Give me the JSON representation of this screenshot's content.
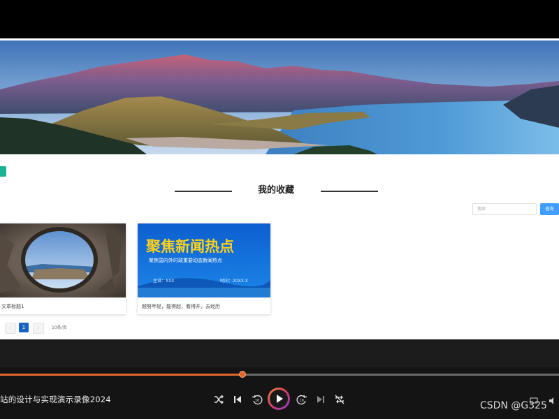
{
  "page": {
    "section_title": "我的收藏",
    "search": {
      "placeholder": "搜索",
      "button_label": "查询"
    },
    "cards": [
      {
        "caption": "文章标题1"
      },
      {
        "caption": "越努年轻，能得起，看得开，去经历",
        "poster_title": "聚焦新闻热点",
        "poster_subtitle": "聚焦国内外时政重要动态新闻热点",
        "poster_left": "主讲：XXX",
        "poster_right": "时间：20XX.X"
      }
    ],
    "pagination": {
      "prev": "‹",
      "current_page": "1",
      "next": "›",
      "page_size": "10条/页"
    }
  },
  "player": {
    "video_title": "站的设计与实现演示录像2024",
    "progress": 0.434,
    "watermark": "CSDN @G325",
    "controls": [
      "shuffle-icon",
      "skip-previous-icon",
      "rewind-10-icon",
      "play-icon",
      "forward-10-icon",
      "skip-next-icon",
      "repeat-off-icon"
    ],
    "colors": {
      "accent": "#e2672f",
      "search_button": "#409eff",
      "page_active": "#1565c0",
      "tab_green": "#1ab394"
    }
  }
}
